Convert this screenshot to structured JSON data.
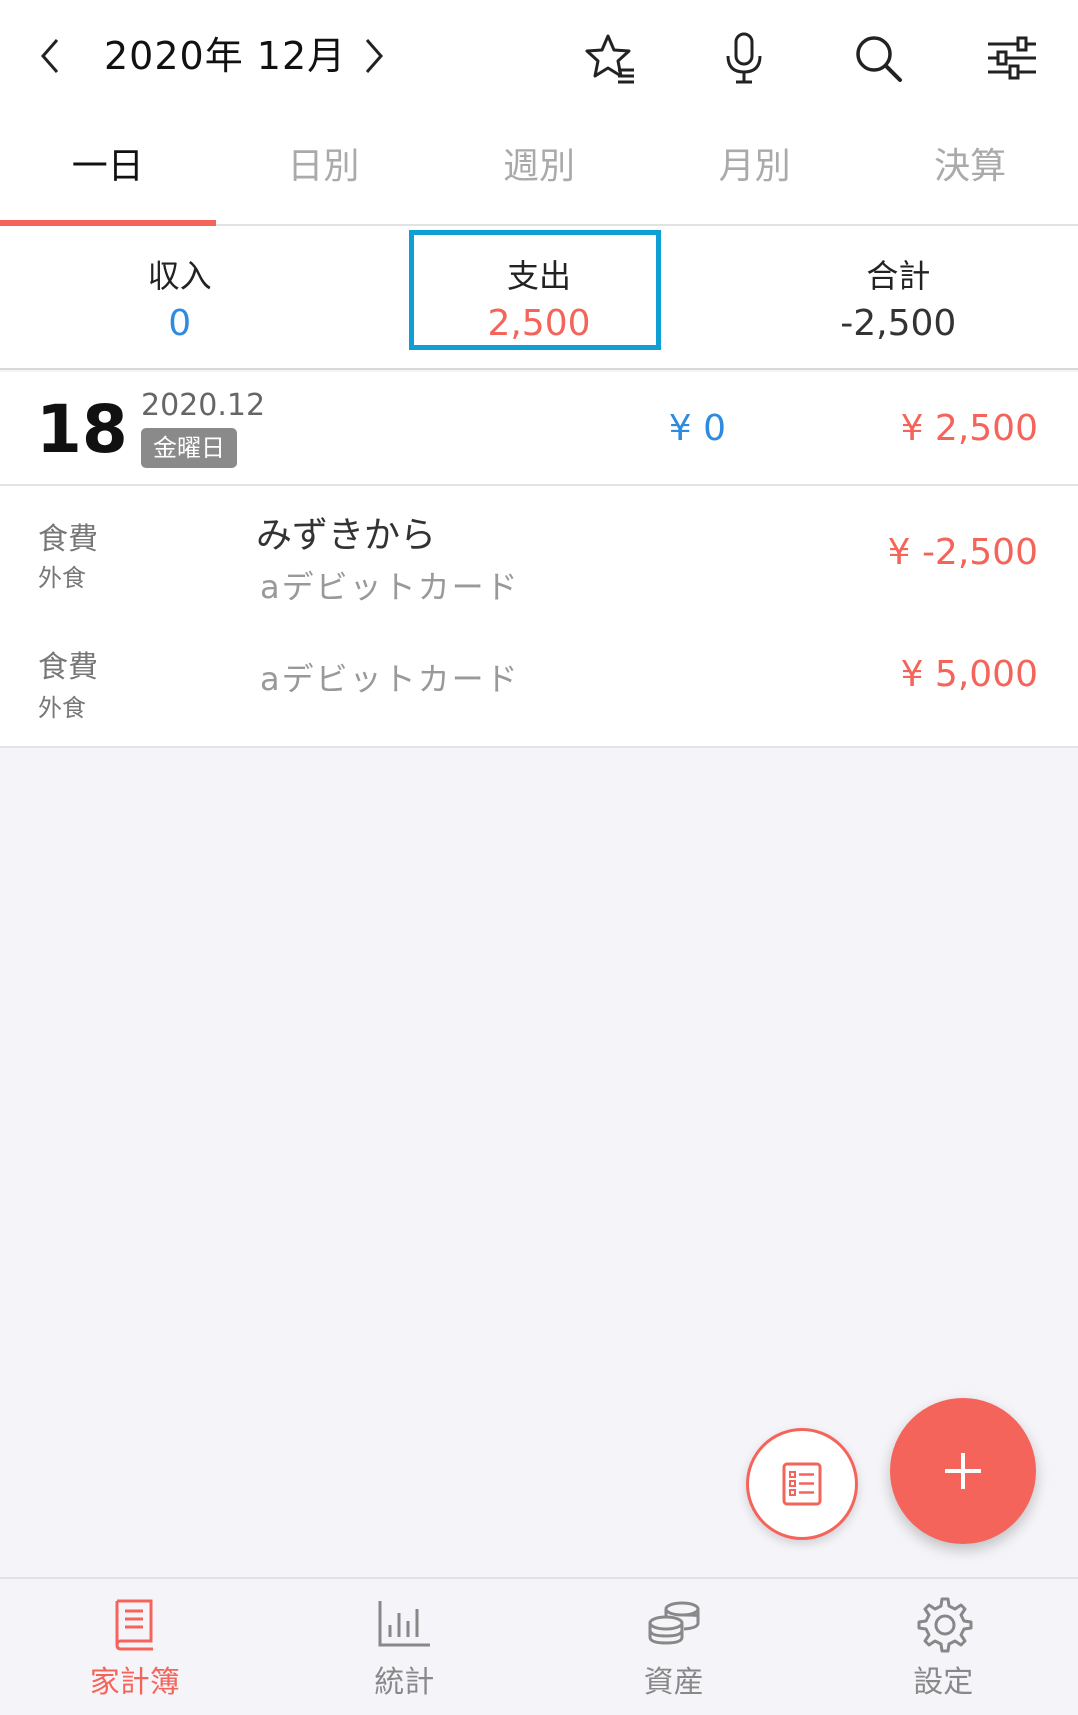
{
  "header": {
    "month_label": "2020年 12月",
    "icons": [
      "chevron-left-icon",
      "chevron-right-icon",
      "star-list-icon",
      "microphone-icon",
      "search-icon",
      "filter-sliders-icon"
    ]
  },
  "tabs": [
    {
      "label": "一日",
      "active": true
    },
    {
      "label": "日別",
      "active": false
    },
    {
      "label": "週別",
      "active": false
    },
    {
      "label": "月別",
      "active": false
    },
    {
      "label": "決算",
      "active": false
    }
  ],
  "summary": {
    "income_label": "収入",
    "income_value": "0",
    "expense_label": "支出",
    "expense_value": "2,500",
    "total_label": "合計",
    "total_value": "-2,500"
  },
  "day": {
    "day_number": "18",
    "year_month": "2020.12",
    "weekday": "金曜日",
    "income": "¥ 0",
    "expense": "¥ 2,500"
  },
  "entries": [
    {
      "category": "食費",
      "subcategory": "外食",
      "title": "みずきから",
      "account": "aデビットカード",
      "amount": "¥ -2,500"
    },
    {
      "category": "食費",
      "subcategory": "外食",
      "title": "",
      "account": "aデビットカード",
      "amount": "¥ 5,000"
    }
  ],
  "colors": {
    "accent": "#f5645a",
    "income": "#2e8be0",
    "highlight": "#0f9fd6"
  },
  "bottom_nav": [
    {
      "label": "家計簿",
      "icon": "book-icon",
      "active": true
    },
    {
      "label": "統計",
      "icon": "bar-chart-icon",
      "active": false
    },
    {
      "label": "資産",
      "icon": "coins-icon",
      "active": false
    },
    {
      "label": "設定",
      "icon": "gear-icon",
      "active": false
    }
  ]
}
